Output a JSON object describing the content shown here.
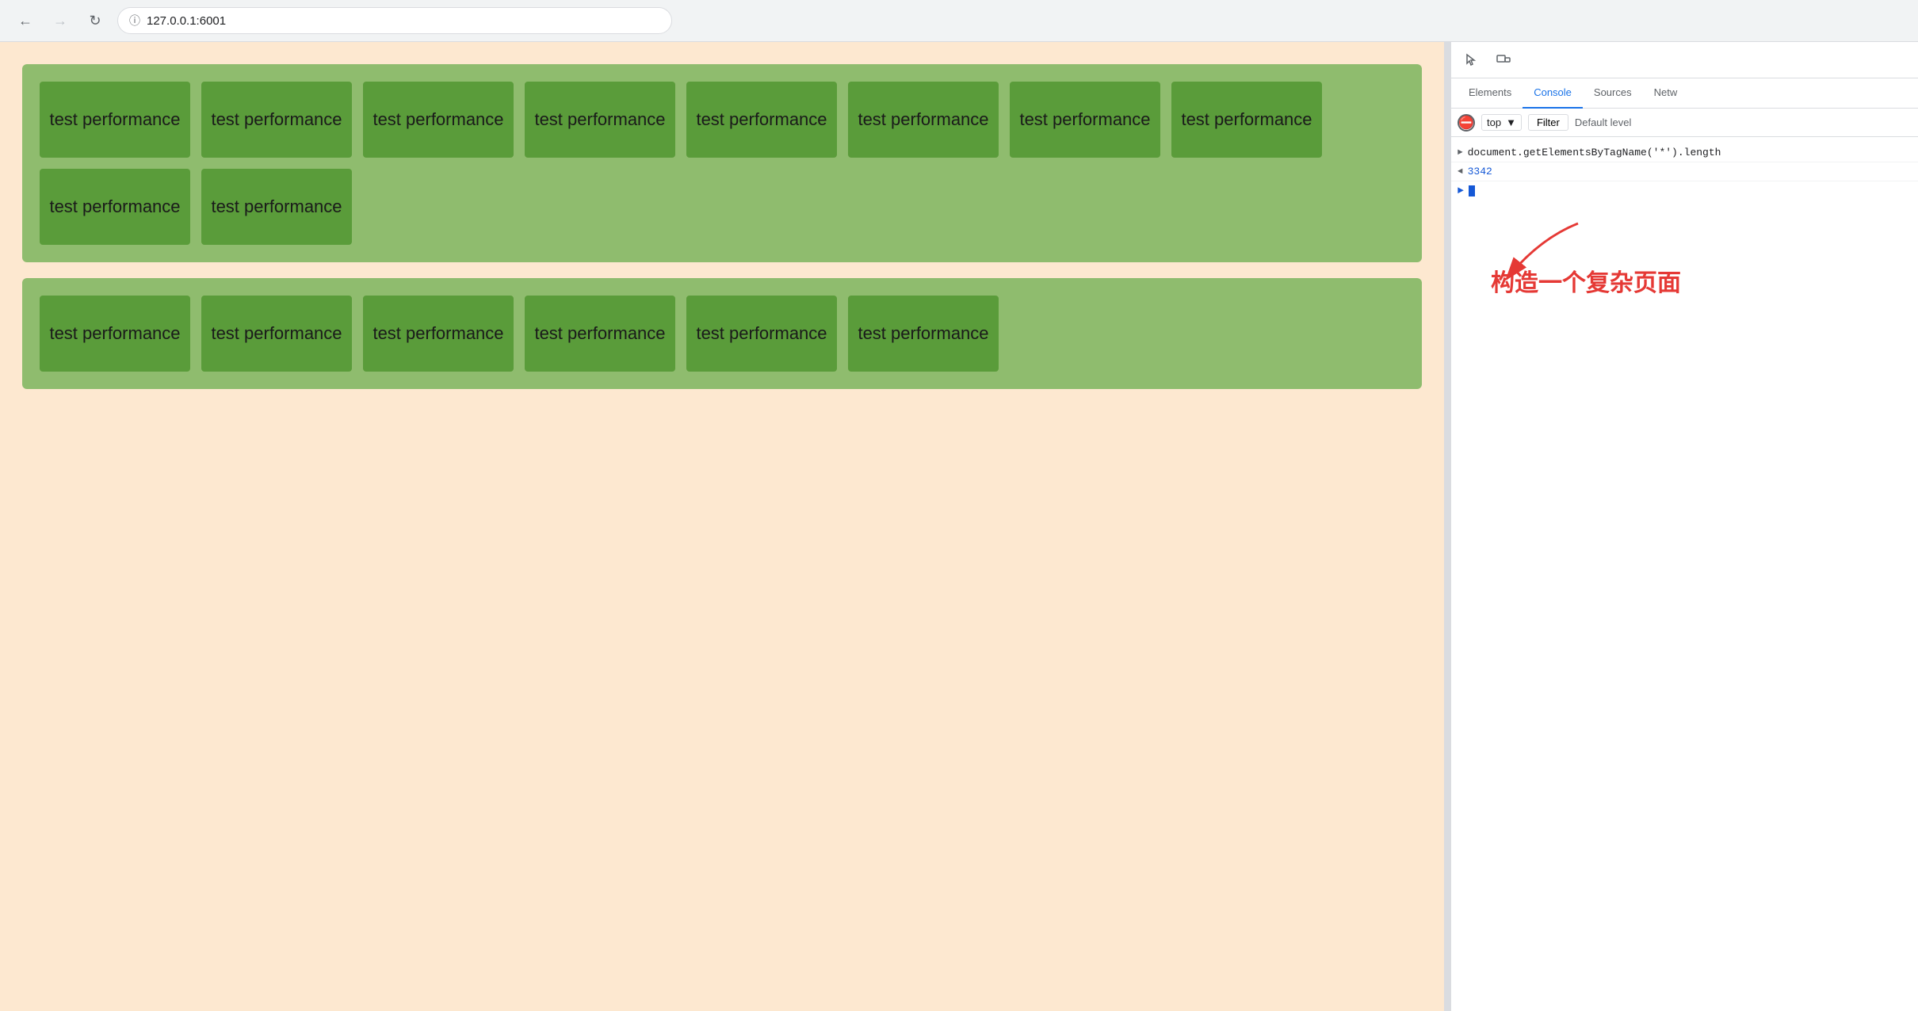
{
  "browser": {
    "url": "127.0.0.1:6001",
    "back_disabled": false,
    "forward_disabled": true
  },
  "devtools": {
    "tabs": [
      "Elements",
      "Console",
      "Sources",
      "Netw"
    ],
    "active_tab": "Console",
    "console_context": "top",
    "console_filter_label": "Filter",
    "console_level_label": "Default level",
    "console_rows": [
      {
        "type": "input",
        "prefix": ">",
        "text": "document.getElementsByTagName('*').length"
      },
      {
        "type": "output",
        "prefix": "<",
        "text": "3342",
        "is_number": true
      },
      {
        "type": "prompt",
        "prefix": ">",
        "text": ""
      }
    ]
  },
  "annotation": {
    "text": "构造一个复杂页面"
  },
  "sections": [
    {
      "id": "section1",
      "items": [
        "test performance",
        "test performance",
        "test performance",
        "test performance",
        "test performance",
        "test performance",
        "test performance",
        "test performance",
        "test performance",
        "test performance"
      ]
    },
    {
      "id": "section2",
      "items": [
        "test performance",
        "test performance",
        "test performance",
        "test performance",
        "test performance",
        "test performance"
      ]
    }
  ],
  "item_label": "test performance"
}
